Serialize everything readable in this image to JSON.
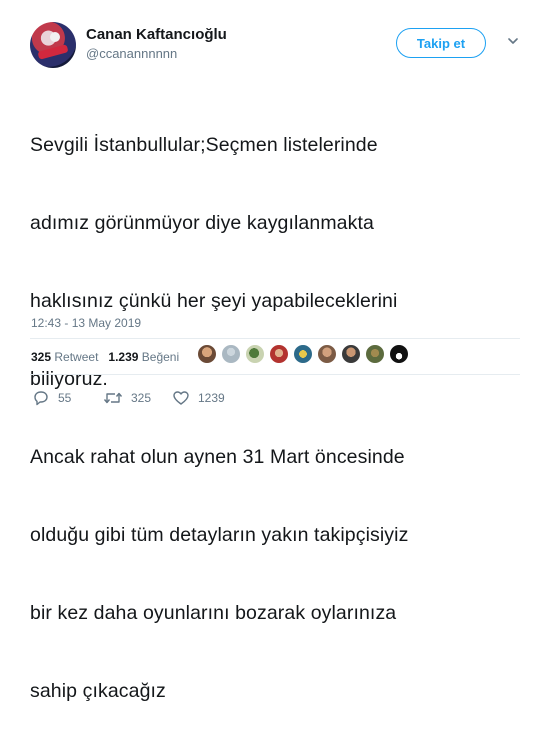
{
  "author": {
    "name": "Canan Kaftancıoğlu",
    "handle": "@ccanannnnnn"
  },
  "follow_button": "Takip et",
  "tweet_lines": [
    "Sevgili İstanbullular;Seçmen listelerinde",
    "adımız görünmüyor diye kaygılanmakta",
    "haklısınız çünkü her şeyi yapabileceklerini",
    "biliyoruz.",
    "Ancak rahat olun aynen 31 Mart öncesinde",
    "olduğu gibi tüm detayların yakın takipçisiyiz",
    "bir kez daha oyunlarını bozarak oylarınıza",
    "sahip çıkacağız"
  ],
  "timestamp": "12:43 - 13 May 2019",
  "stats": {
    "retweets_count": "325",
    "retweets_label": "Retweet",
    "likes_count": "1.239",
    "likes_label": "Beğeni"
  },
  "actions": {
    "replies": "55",
    "retweets": "325",
    "likes": "1239"
  },
  "colors": {
    "accent": "#1da1f2",
    "text": "#14171a",
    "muted": "#657786"
  }
}
